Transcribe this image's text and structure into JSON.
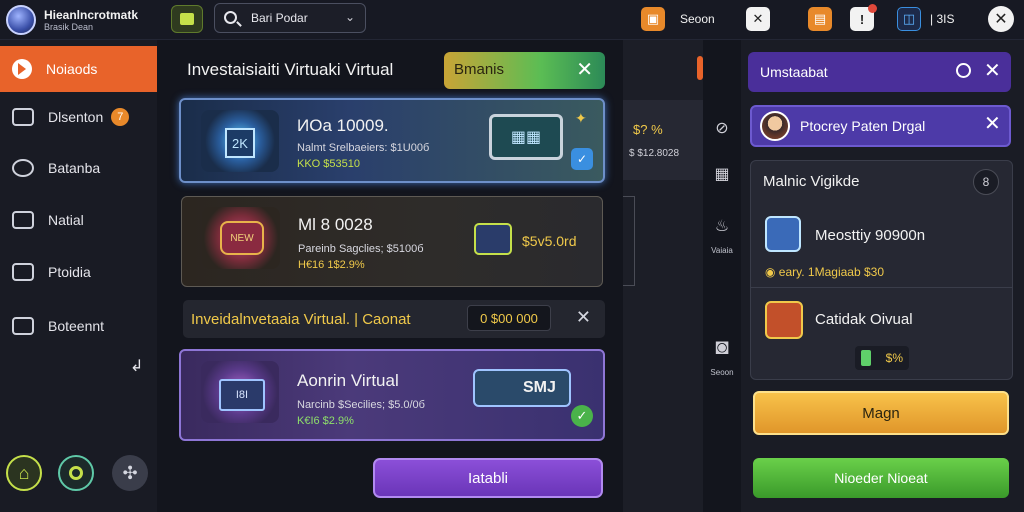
{
  "app": {
    "title": "Hieanlncrotmatk",
    "subtitle": "Brasik Dean"
  },
  "topbar": {
    "search_value": "Bari Podar",
    "orange_label": "Seoon",
    "coins": "| 3IS",
    "icons": {
      "home": "home-icon",
      "search": "search-icon",
      "chevron": "chevron-down-icon",
      "orange": "chat-icon",
      "check": "check-icon",
      "gift": "gift-icon",
      "bell": "bell-icon",
      "shield": "shield-icon",
      "close": "close-icon"
    }
  },
  "sidebar": {
    "items": [
      {
        "label": "Noiaods",
        "active": true
      },
      {
        "label": "Dlsenton",
        "badge": "7"
      },
      {
        "label": "Batanba"
      },
      {
        "label": "Natial"
      },
      {
        "label": "Ptoidia"
      },
      {
        "label": "Boteennt"
      }
    ]
  },
  "main": {
    "title": "Investaisiaiti Virtuaki Virtual",
    "filter_label": "Bmanis",
    "cards": [
      {
        "thumb": "2K",
        "title": "ИOa 10009.",
        "line1": "Nalmt Srelbaeiers: $1U00б",
        "line2": "KKO $53510"
      },
      {
        "thumb": "NEW",
        "title": "Ml 8 0028",
        "line1": "Pareinb Sagclies; $5100б",
        "line2": "H€16 1$2.9%",
        "price": "$5v5.0rd"
      },
      {
        "thumb": "I8I",
        "title": "Aonrin Virtual",
        "line1": "Narcinb $Secilies; $5.0/0б",
        "line2": "K€I6 $2.9%",
        "badge": "SMJ"
      }
    ],
    "banner": {
      "text": "Inveidalnvetaaia Virtual. | Caonat",
      "value": "0 $00 000"
    },
    "primary_button": "Iatabli"
  },
  "rail": {
    "card_top": "$? %",
    "card_bottom": "$ $12.8028",
    "labels": [
      "Vaiaia",
      "Seoon"
    ]
  },
  "right": {
    "header": "Umstaabat",
    "user": "Ptocrey Paten Drgal",
    "list_title": "Malnic Vigikde",
    "list_count": "8",
    "item1": {
      "title": "Meosttiy 90900n",
      "sub": "◉ eary. 1Magiaab $30"
    },
    "item2": {
      "title": "Catidak Oivual",
      "sub": "$%"
    },
    "button1": "Magn",
    "button2": "Nioeder Nioeat"
  }
}
